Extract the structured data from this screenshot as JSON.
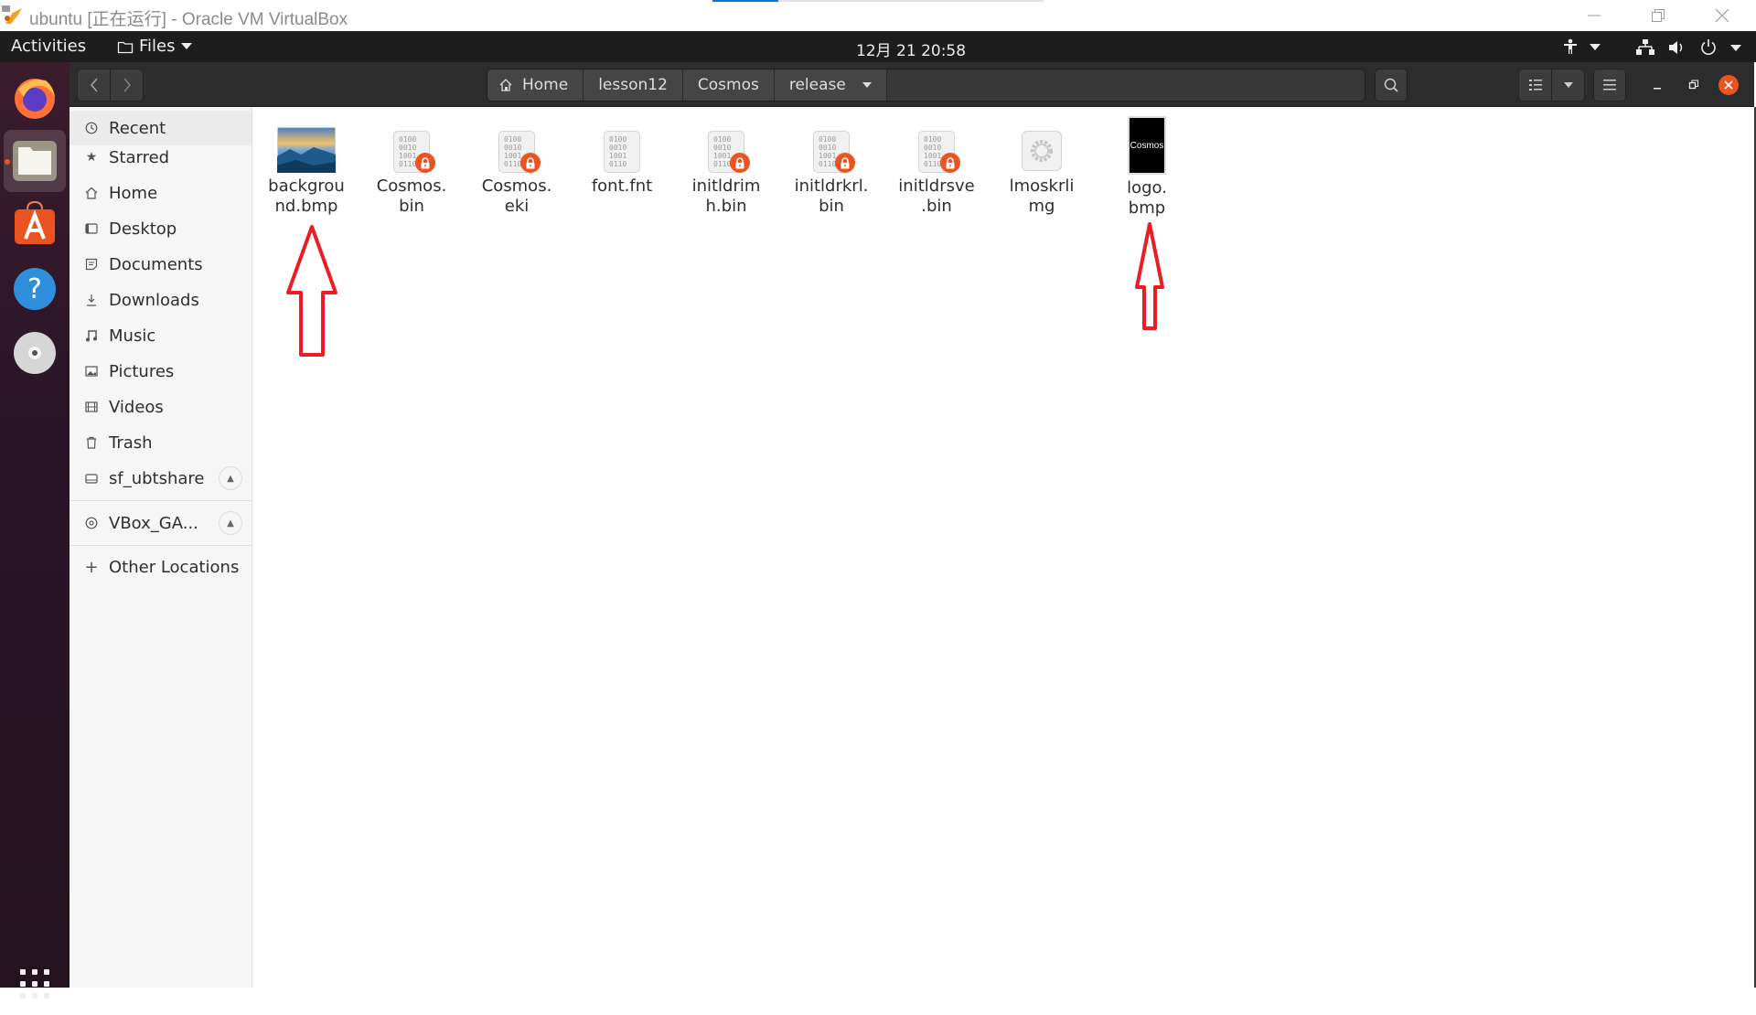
{
  "vbox": {
    "title": "ubuntu [正在运行] - Oracle VM VirtualBox",
    "progress": 0.2,
    "controls": [
      "minimize",
      "restore",
      "close"
    ]
  },
  "topbar": {
    "activities": "Activities",
    "app_menu": "Files",
    "clock": "12月 21  20:58"
  },
  "dock": {
    "items": [
      {
        "name": "Firefox"
      },
      {
        "name": "Files",
        "running": true,
        "active": true
      },
      {
        "name": "Ubuntu Software"
      },
      {
        "name": "Help"
      },
      {
        "name": "Optical Disc"
      }
    ],
    "apps_grid": "Show Applications"
  },
  "header": {
    "path": [
      "Home",
      "lesson12",
      "Cosmos",
      "release"
    ]
  },
  "sidebar": {
    "items": [
      {
        "label": "Recent",
        "icon": "clock-icon"
      },
      {
        "label": "Starred",
        "icon": "star-icon"
      },
      {
        "label": "Home",
        "icon": "home-icon"
      },
      {
        "label": "Desktop",
        "icon": "desktop-icon"
      },
      {
        "label": "Documents",
        "icon": "document-icon"
      },
      {
        "label": "Downloads",
        "icon": "download-icon"
      },
      {
        "label": "Music",
        "icon": "music-icon"
      },
      {
        "label": "Pictures",
        "icon": "picture-icon"
      },
      {
        "label": "Videos",
        "icon": "video-icon"
      },
      {
        "label": "Trash",
        "icon": "trash-icon"
      },
      {
        "label": "sf_ubtshare",
        "icon": "drive-icon"
      }
    ],
    "devices": [
      {
        "label": "VBox_GA...",
        "icon": "disc-icon"
      }
    ],
    "other": {
      "label": "Other Locations",
      "icon": "plus-icon"
    }
  },
  "files": [
    {
      "line1": "backgrou",
      "line2": "nd.bmp",
      "type": "image"
    },
    {
      "line1": "Cosmos.",
      "line2": "bin",
      "type": "binary-locked"
    },
    {
      "line1": "Cosmos.",
      "line2": "eki",
      "type": "binary-locked"
    },
    {
      "line1": "font.fnt",
      "line2": "",
      "type": "binary"
    },
    {
      "line1": "initldrim",
      "line2": "h.bin",
      "type": "binary-locked"
    },
    {
      "line1": "initldrkrl.",
      "line2": "bin",
      "type": "binary-locked"
    },
    {
      "line1": "initldrsve",
      "line2": ".bin",
      "type": "binary-locked"
    },
    {
      "line1": "lmoskrli",
      "line2": "mg",
      "type": "executable"
    },
    {
      "line1": "logo.",
      "line2": "bmp",
      "type": "logo-image"
    }
  ],
  "logo_thumb_text": "Cosmos",
  "binary_text": "0100\n0010\n1001\n0110",
  "annotations": [
    "arrow pointing to background.bmp",
    "arrow pointing to logo.bmp"
  ],
  "colors": {
    "accent": "#e95420",
    "annotation": "#ed1c24",
    "header": "#2d2d2d",
    "topbar": "#1d1d1d"
  }
}
